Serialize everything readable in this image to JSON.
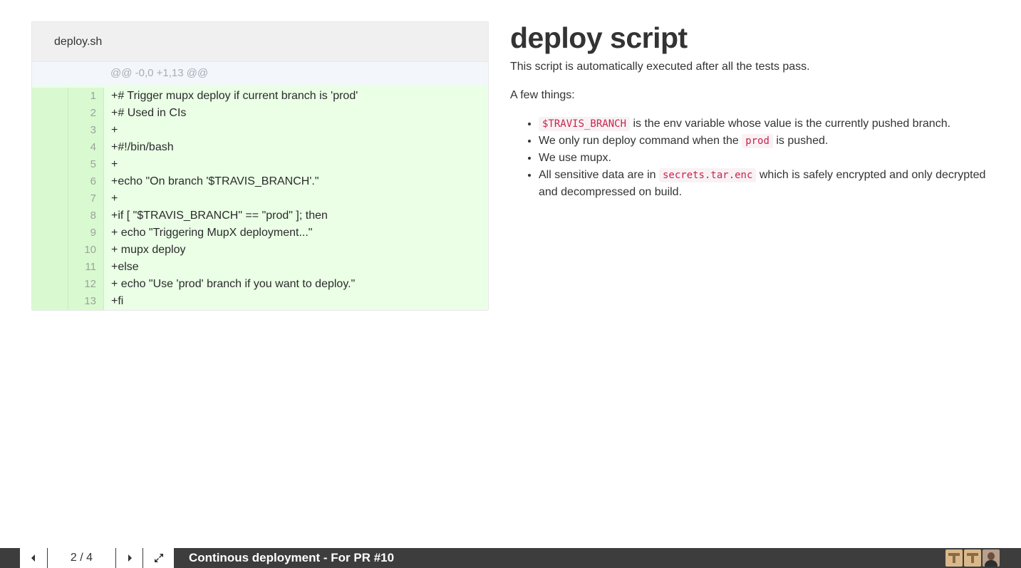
{
  "diff": {
    "filename": "deploy.sh",
    "hunk_header": "@@ -0,0 +1,13 @@",
    "lines": [
      {
        "num": "1",
        "text": "+# Trigger mupx deploy if current branch is 'prod'"
      },
      {
        "num": "2",
        "text": "+# Used in CIs"
      },
      {
        "num": "3",
        "text": "+"
      },
      {
        "num": "4",
        "text": "+#!/bin/bash"
      },
      {
        "num": "5",
        "text": "+"
      },
      {
        "num": "6",
        "text": "+echo \"On branch '$TRAVIS_BRANCH'.\""
      },
      {
        "num": "7",
        "text": "+"
      },
      {
        "num": "8",
        "text": "+if [ \"$TRAVIS_BRANCH\" == \"prod\" ]; then"
      },
      {
        "num": "9",
        "text": "+ echo \"Triggering MupX deployment...\""
      },
      {
        "num": "10",
        "text": "+ mupx deploy"
      },
      {
        "num": "11",
        "text": "+else"
      },
      {
        "num": "12",
        "text": "+ echo \"Use 'prod' branch if you want to deploy.\""
      },
      {
        "num": "13",
        "text": "+fi"
      }
    ],
    "colors": {
      "added_bg": "#eaffe6",
      "gutter_bg": "#d9f9d0",
      "hunk_bg": "#f3f7fc"
    }
  },
  "notes": {
    "title": "deploy script",
    "intro": "This script is automatically executed after all the tests pass.",
    "subhead": "A few things:",
    "bullets": {
      "b1_code": "$TRAVIS_BRANCH",
      "b1_text": " is the env variable whose value is the currently pushed branch.",
      "b2_text_before": "We only run deploy command when the ",
      "b2_code": "prod",
      "b2_text_after": " is pushed.",
      "b3_text": "We use mupx.",
      "b4_text_before": "All sensitive data are in ",
      "b4_code": "secrets.tar.enc",
      "b4_text_after": " which is safely encrypted and only decrypted and decompressed on build."
    }
  },
  "footer": {
    "prev_icon": "caret-left-icon",
    "next_icon": "caret-right-icon",
    "fullscreen_icon": "expand-icon",
    "pager": "2 / 4",
    "title": "Continous deployment - For PR #10",
    "bar_color": "#3d3d3d"
  }
}
